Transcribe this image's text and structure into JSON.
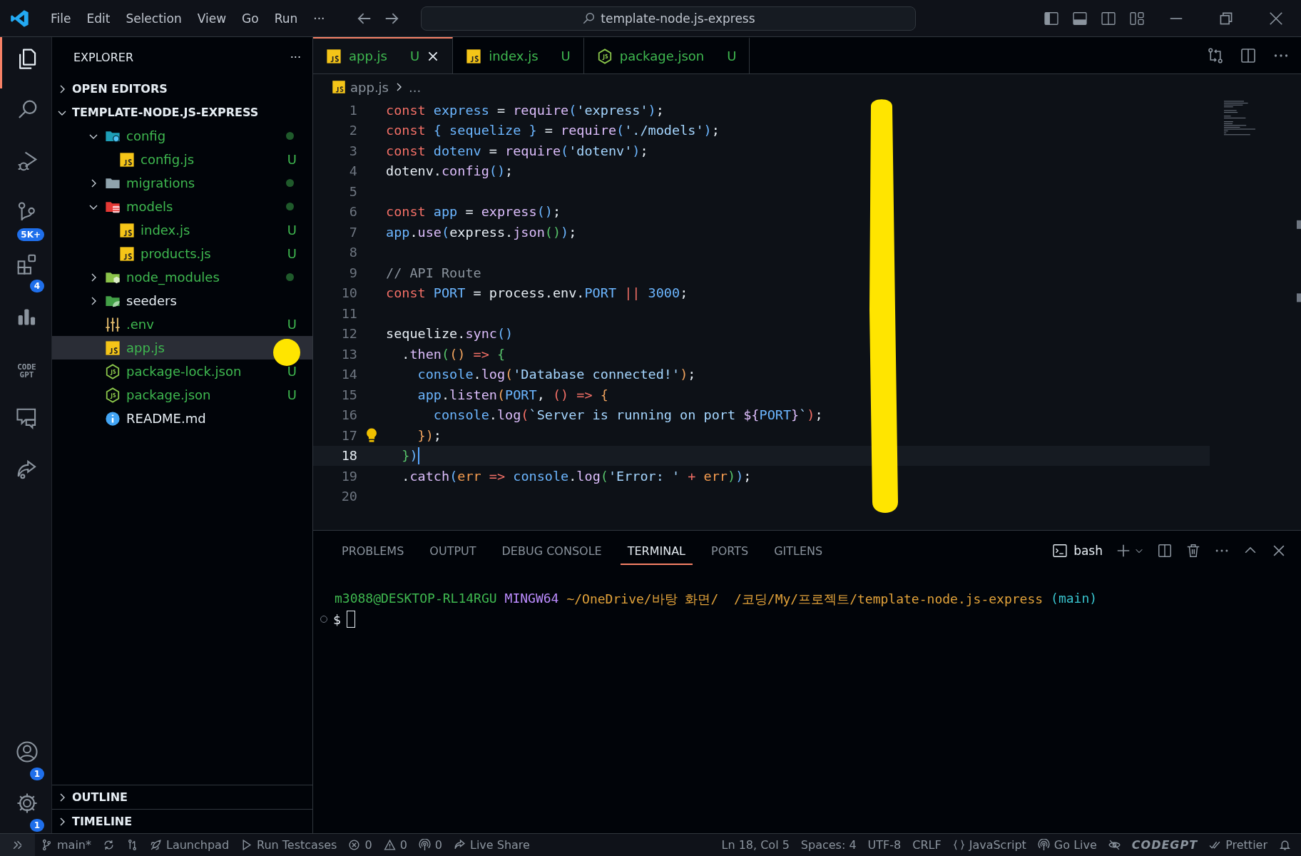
{
  "title_bar": {
    "menu": [
      "File",
      "Edit",
      "Selection",
      "View",
      "Go",
      "Run",
      "···"
    ],
    "search": "template-node.js-express"
  },
  "activity_bar": {
    "items": [
      {
        "kind": "files",
        "selected": true
      },
      {
        "kind": "search",
        "selected": false
      },
      {
        "kind": "debug",
        "selected": false
      },
      {
        "kind": "scm",
        "badge": "5K+",
        "selected": false
      },
      {
        "kind": "extensions",
        "badge": "4",
        "selected": false
      },
      {
        "kind": "chart",
        "selected": false
      },
      {
        "kind": "codegpt",
        "label": "CODE GPT",
        "selected": false
      },
      {
        "kind": "chat",
        "selected": false
      },
      {
        "kind": "share",
        "selected": false
      }
    ],
    "bottom": [
      {
        "kind": "account",
        "badge": "1"
      },
      {
        "kind": "gear",
        "badge": "1"
      }
    ]
  },
  "sidebar": {
    "title": "EXPLORER",
    "more": "···",
    "sections": [
      {
        "label": "OPEN EDITORS",
        "expanded": false
      },
      {
        "label": "TEMPLATE-NODE.JS-EXPRESS",
        "expanded": true
      }
    ],
    "tree": [
      {
        "label": "config",
        "kind": "gear",
        "expanded": true,
        "untracked": true,
        "changed": true,
        "selected": false,
        "children": [
          {
            "label": "config.js",
            "kind": "js",
            "untracked": true,
            "changed": false,
            "badge": "U",
            "selected": false
          }
        ]
      },
      {
        "label": "migrations",
        "kind": "folder",
        "expanded": false,
        "untracked": true,
        "changed": true,
        "selected": false
      },
      {
        "label": "models",
        "kind": "database",
        "expanded": true,
        "untracked": true,
        "changed": true,
        "selected": false,
        "children": [
          {
            "label": "index.js",
            "kind": "js",
            "untracked": true,
            "changed": false,
            "badge": "U",
            "selected": false
          },
          {
            "label": "products.js",
            "kind": "js",
            "untracked": true,
            "changed": false,
            "badge": "U",
            "selected": false
          }
        ]
      },
      {
        "label": "node_modules",
        "kind": "module",
        "expanded": false,
        "untracked": true,
        "changed": true,
        "selected": false
      },
      {
        "label": "seeders",
        "kind": "leaf",
        "expanded": false,
        "untracked": false,
        "changed": false,
        "selected": false
      },
      {
        "label": ".env",
        "kind": "env",
        "untracked": true,
        "changed": false,
        "badge": "U",
        "selected": false
      },
      {
        "label": "app.js",
        "kind": "js",
        "untracked": true,
        "changed": false,
        "selected": true
      },
      {
        "label": "package-lock.json",
        "kind": "nodejs",
        "untracked": true,
        "changed": false,
        "badge": "U",
        "selected": false
      },
      {
        "label": "package.json",
        "kind": "nodejs",
        "untracked": true,
        "changed": false,
        "badge": "U",
        "selected": false
      },
      {
        "label": "README.md",
        "kind": "info",
        "untracked": false,
        "changed": false,
        "selected": false
      }
    ],
    "bottom_sections": [
      {
        "label": "OUTLINE",
        "expanded": false
      },
      {
        "label": "TIMELINE",
        "expanded": false
      }
    ]
  },
  "editor": {
    "tabs": [
      {
        "label": "app.js",
        "kind": "js",
        "badge": "U",
        "selected": true
      },
      {
        "label": "index.js",
        "kind": "js",
        "badge": "U",
        "selected": false
      },
      {
        "label": "package.json",
        "kind": "nodejs",
        "badge": "U",
        "selected": false
      }
    ],
    "breadcrumb": [
      "app.js",
      "..."
    ],
    "lines": [
      {
        "number": "1",
        "current": false,
        "tokens": [
          {
            "text": "const ",
            "kind": "kw"
          },
          {
            "text": "express",
            "kind": "var"
          },
          {
            "text": " = ",
            "kind": "plain"
          },
          {
            "text": "require",
            "kind": "fn"
          },
          {
            "text": "(",
            "kind": "b1"
          },
          {
            "text": "'express'",
            "kind": "str"
          },
          {
            "text": ")",
            "kind": "b1"
          },
          {
            "text": ";",
            "kind": "plain"
          }
        ]
      },
      {
        "number": "2",
        "current": false,
        "tokens": [
          {
            "text": "const ",
            "kind": "kw"
          },
          {
            "text": "{",
            "kind": "b1"
          },
          {
            "text": " sequelize ",
            "kind": "var"
          },
          {
            "text": "}",
            "kind": "b1"
          },
          {
            "text": " = ",
            "kind": "plain"
          },
          {
            "text": "require",
            "kind": "fn"
          },
          {
            "text": "(",
            "kind": "b1"
          },
          {
            "text": "'./models'",
            "kind": "str"
          },
          {
            "text": ")",
            "kind": "b1"
          },
          {
            "text": ";",
            "kind": "plain"
          }
        ]
      },
      {
        "number": "3",
        "current": false,
        "tokens": [
          {
            "text": "const ",
            "kind": "kw"
          },
          {
            "text": "dotenv",
            "kind": "var"
          },
          {
            "text": " = ",
            "kind": "plain"
          },
          {
            "text": "require",
            "kind": "fn"
          },
          {
            "text": "(",
            "kind": "b1"
          },
          {
            "text": "'dotenv'",
            "kind": "str"
          },
          {
            "text": ")",
            "kind": "b1"
          },
          {
            "text": ";",
            "kind": "plain"
          }
        ]
      },
      {
        "number": "4",
        "current": false,
        "tokens": [
          {
            "text": "dotenv.",
            "kind": "plain"
          },
          {
            "text": "config",
            "kind": "fn"
          },
          {
            "text": "()",
            "kind": "b1"
          },
          {
            "text": ";",
            "kind": "plain"
          }
        ]
      },
      {
        "number": "5",
        "current": false
      },
      {
        "number": "6",
        "current": false,
        "tokens": [
          {
            "text": "const ",
            "kind": "kw"
          },
          {
            "text": "app",
            "kind": "var"
          },
          {
            "text": " = ",
            "kind": "plain"
          },
          {
            "text": "express",
            "kind": "fn"
          },
          {
            "text": "()",
            "kind": "b1"
          },
          {
            "text": ";",
            "kind": "plain"
          }
        ]
      },
      {
        "number": "7",
        "current": false,
        "tokens": [
          {
            "text": "app",
            "kind": "var"
          },
          {
            "text": ".",
            "kind": "plain"
          },
          {
            "text": "use",
            "kind": "fn"
          },
          {
            "text": "(",
            "kind": "b1"
          },
          {
            "text": "express.",
            "kind": "plain"
          },
          {
            "text": "json",
            "kind": "fn"
          },
          {
            "text": "()",
            "kind": "b2"
          },
          {
            "text": ")",
            "kind": "b1"
          },
          {
            "text": ";",
            "kind": "plain"
          }
        ]
      },
      {
        "number": "8",
        "current": false
      },
      {
        "number": "9",
        "current": false,
        "tokens": [
          {
            "text": "// API Route",
            "kind": "comment"
          }
        ]
      },
      {
        "number": "10",
        "current": false,
        "tokens": [
          {
            "text": "const ",
            "kind": "kw"
          },
          {
            "text": "PORT",
            "kind": "var"
          },
          {
            "text": " = ",
            "kind": "plain"
          },
          {
            "text": "process.env.",
            "kind": "plain"
          },
          {
            "text": "PORT ",
            "kind": "var"
          },
          {
            "text": "|| ",
            "kind": "kw"
          },
          {
            "text": "3000",
            "kind": "num"
          },
          {
            "text": ";",
            "kind": "plain"
          }
        ]
      },
      {
        "number": "11",
        "current": false
      },
      {
        "number": "12",
        "current": false,
        "tokens": [
          {
            "text": "sequelize.",
            "kind": "plain"
          },
          {
            "text": "sync",
            "kind": "fn"
          },
          {
            "text": "()",
            "kind": "b1"
          }
        ]
      },
      {
        "number": "13",
        "current": false,
        "tokens": [
          {
            "text": "  .",
            "kind": "plain"
          },
          {
            "text": "then",
            "kind": "fn"
          },
          {
            "text": "(",
            "kind": "b2"
          },
          {
            "text": "()",
            "kind": "b3"
          },
          {
            "text": " => ",
            "kind": "kw"
          },
          {
            "text": "{",
            "kind": "b2"
          }
        ]
      },
      {
        "number": "14",
        "current": false,
        "tokens": [
          {
            "text": "    console",
            "kind": "var"
          },
          {
            "text": ".",
            "kind": "plain"
          },
          {
            "text": "log",
            "kind": "fn"
          },
          {
            "text": "(",
            "kind": "b3"
          },
          {
            "text": "'Database connected!'",
            "kind": "str"
          },
          {
            "text": ")",
            "kind": "b3"
          },
          {
            "text": ";",
            "kind": "plain"
          }
        ]
      },
      {
        "number": "15",
        "current": false,
        "tokens": [
          {
            "text": "    app",
            "kind": "var"
          },
          {
            "text": ".",
            "kind": "plain"
          },
          {
            "text": "listen",
            "kind": "fn"
          },
          {
            "text": "(",
            "kind": "b3"
          },
          {
            "text": "PORT",
            "kind": "var"
          },
          {
            "text": ", ",
            "kind": "plain"
          },
          {
            "text": "()",
            "kind": "kw"
          },
          {
            "text": " => ",
            "kind": "kw"
          },
          {
            "text": "{",
            "kind": "b3"
          }
        ]
      },
      {
        "number": "16",
        "current": false,
        "tokens": [
          {
            "text": "      console",
            "kind": "var"
          },
          {
            "text": ".",
            "kind": "plain"
          },
          {
            "text": "log",
            "kind": "fn"
          },
          {
            "text": "(",
            "kind": "kw"
          },
          {
            "text": "`Server is running on port ",
            "kind": "str"
          },
          {
            "text": "${",
            "kind": "fn"
          },
          {
            "text": "PORT",
            "kind": "var"
          },
          {
            "text": "}",
            "kind": "fn"
          },
          {
            "text": "`",
            "kind": "str"
          },
          {
            "text": ")",
            "kind": "kw"
          },
          {
            "text": ";",
            "kind": "plain"
          }
        ]
      },
      {
        "number": "17",
        "current": false,
        "lightbulb": true,
        "tokens": [
          {
            "text": "    }",
            "kind": "b3"
          },
          {
            "text": ")",
            "kind": "b3"
          },
          {
            "text": ";",
            "kind": "plain"
          }
        ]
      },
      {
        "number": "18",
        "current": true,
        "tokens": [
          {
            "text": "  }",
            "kind": "b2"
          },
          {
            "text": ")",
            "kind": "b1"
          }
        ]
      },
      {
        "number": "19",
        "current": false,
        "tokens": [
          {
            "text": "  .",
            "kind": "plain"
          },
          {
            "text": "catch",
            "kind": "fn"
          },
          {
            "text": "(",
            "kind": "b1"
          },
          {
            "text": "err",
            "kind": "param"
          },
          {
            "text": " => ",
            "kind": "kw"
          },
          {
            "text": "console",
            "kind": "var"
          },
          {
            "text": ".",
            "kind": "plain"
          },
          {
            "text": "log",
            "kind": "fn"
          },
          {
            "text": "(",
            "kind": "b2"
          },
          {
            "text": "'Error: '",
            "kind": "str"
          },
          {
            "text": " + ",
            "kind": "kw"
          },
          {
            "text": "err",
            "kind": "param"
          },
          {
            "text": ")",
            "kind": "b2"
          },
          {
            "text": ")",
            "kind": "b1"
          },
          {
            "text": ";",
            "kind": "plain"
          }
        ]
      },
      {
        "number": "20",
        "current": false
      }
    ]
  },
  "panel": {
    "tabs": [
      {
        "label": "PROBLEMS",
        "selected": false
      },
      {
        "label": "OUTPUT",
        "selected": false
      },
      {
        "label": "DEBUG CONSOLE",
        "selected": false
      },
      {
        "label": "TERMINAL",
        "selected": true
      },
      {
        "label": "PORTS",
        "selected": false
      },
      {
        "label": "GITLENS",
        "selected": false
      }
    ],
    "shell": "bash",
    "terminal": {
      "segments": [
        {
          "text": "m3088@DESKTOP-RL14RGU",
          "kind": "user"
        },
        {
          "text": "MINGW64",
          "kind": "system"
        },
        {
          "text": "~/OneDrive/바탕 화면/  /코딩/My/프로젝트/template-node.js-express",
          "kind": "path"
        },
        {
          "text": "(main)",
          "kind": "branch"
        }
      ],
      "prompt": "$"
    }
  },
  "status_bar": {
    "left": [
      {
        "kind": "remote"
      },
      {
        "kind": "branch",
        "text": "main*"
      },
      {
        "kind": "sync"
      },
      {
        "kind": "graph"
      },
      {
        "kind": "rocket",
        "text": "Launchpad"
      },
      {
        "kind": "play",
        "text": "Run Testcases"
      },
      {
        "kind": "error",
        "text": "0"
      },
      {
        "kind": "warning",
        "text": "0"
      },
      {
        "kind": "broadcast",
        "text": "0"
      },
      {
        "kind": "liveshare",
        "text": "Live Share"
      }
    ],
    "right": [
      {
        "kind": "text",
        "text": "Ln 18, Col 5"
      },
      {
        "kind": "text",
        "text": "Spaces: 4"
      },
      {
        "kind": "text",
        "text": "UTF-8"
      },
      {
        "kind": "text",
        "text": "CRLF"
      },
      {
        "kind": "braces",
        "text": "JavaScript"
      },
      {
        "kind": "broadcast",
        "text": "Go Live"
      },
      {
        "kind": "hidden"
      },
      {
        "kind": "logo",
        "text": "CODEGPT"
      },
      {
        "kind": "checks",
        "text": "Prettier"
      },
      {
        "kind": "bell"
      }
    ]
  }
}
